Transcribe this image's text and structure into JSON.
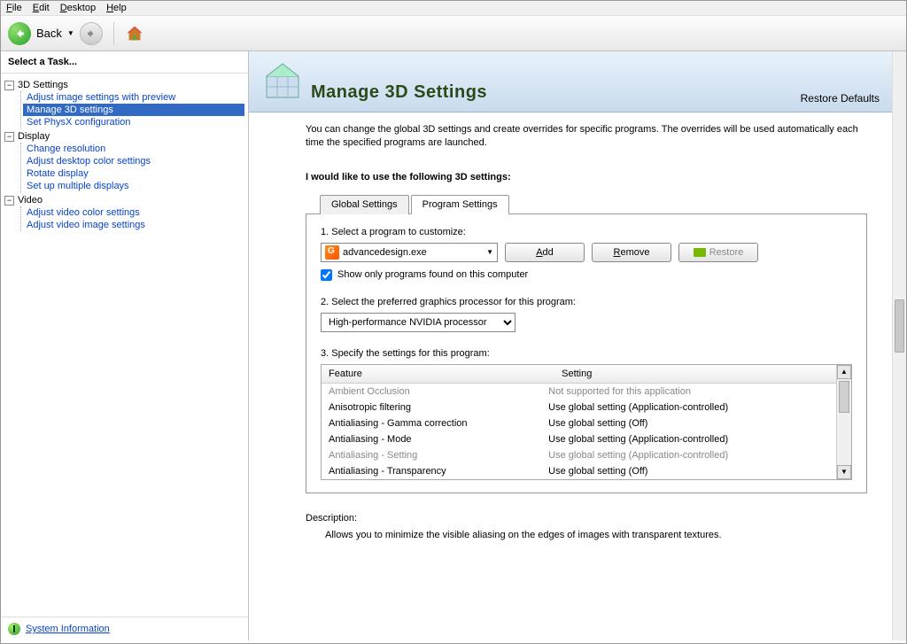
{
  "menubar": {
    "file": "File",
    "edit": "Edit",
    "desktop": "Desktop",
    "help": "Help"
  },
  "toolbar": {
    "back": "Back"
  },
  "sidebar": {
    "task_header": "Select a Task...",
    "groups": [
      {
        "label": "3D Settings",
        "items": [
          "Adjust image settings with preview",
          "Manage 3D settings",
          "Set PhysX configuration"
        ]
      },
      {
        "label": "Display",
        "items": [
          "Change resolution",
          "Adjust desktop color settings",
          "Rotate display",
          "Set up multiple displays"
        ]
      },
      {
        "label": "Video",
        "items": [
          "Adjust video color settings",
          "Adjust video image settings"
        ]
      }
    ],
    "system_info": "System Information"
  },
  "page": {
    "title": "Manage 3D Settings",
    "restore": "Restore Defaults",
    "intro": "You can change the global 3D settings and create overrides for specific programs. The overrides will be used automatically each time the specified programs are launched.",
    "section_label": "I would like to use the following 3D settings:",
    "tabs": {
      "global": "Global Settings",
      "program": "Program Settings"
    },
    "step1": {
      "label": "1. Select a program to customize:",
      "selected": "advancedesign.exe",
      "add": "Add",
      "remove": "Remove",
      "restore": "Restore",
      "checkbox": "Show only programs found on this computer"
    },
    "step2": {
      "label": "2. Select the preferred graphics processor for this program:",
      "selected": "High-performance NVIDIA processor"
    },
    "step3": {
      "label": "3. Specify the settings for this program:",
      "col1": "Feature",
      "col2": "Setting",
      "rows": [
        {
          "f": "Ambient Occlusion",
          "s": "Not supported for this application",
          "disabled": true
        },
        {
          "f": "Anisotropic filtering",
          "s": "Use global setting (Application-controlled)"
        },
        {
          "f": "Antialiasing - Gamma correction",
          "s": "Use global setting (Off)"
        },
        {
          "f": "Antialiasing - Mode",
          "s": "Use global setting (Application-controlled)"
        },
        {
          "f": "Antialiasing - Setting",
          "s": "Use global setting (Application-controlled)",
          "disabled": true
        },
        {
          "f": "Antialiasing - Transparency",
          "s": "Use global setting (Off)"
        }
      ]
    },
    "desc_label": "Description:",
    "desc_text": "Allows you to minimize the visible aliasing on the edges of images with transparent textures."
  }
}
